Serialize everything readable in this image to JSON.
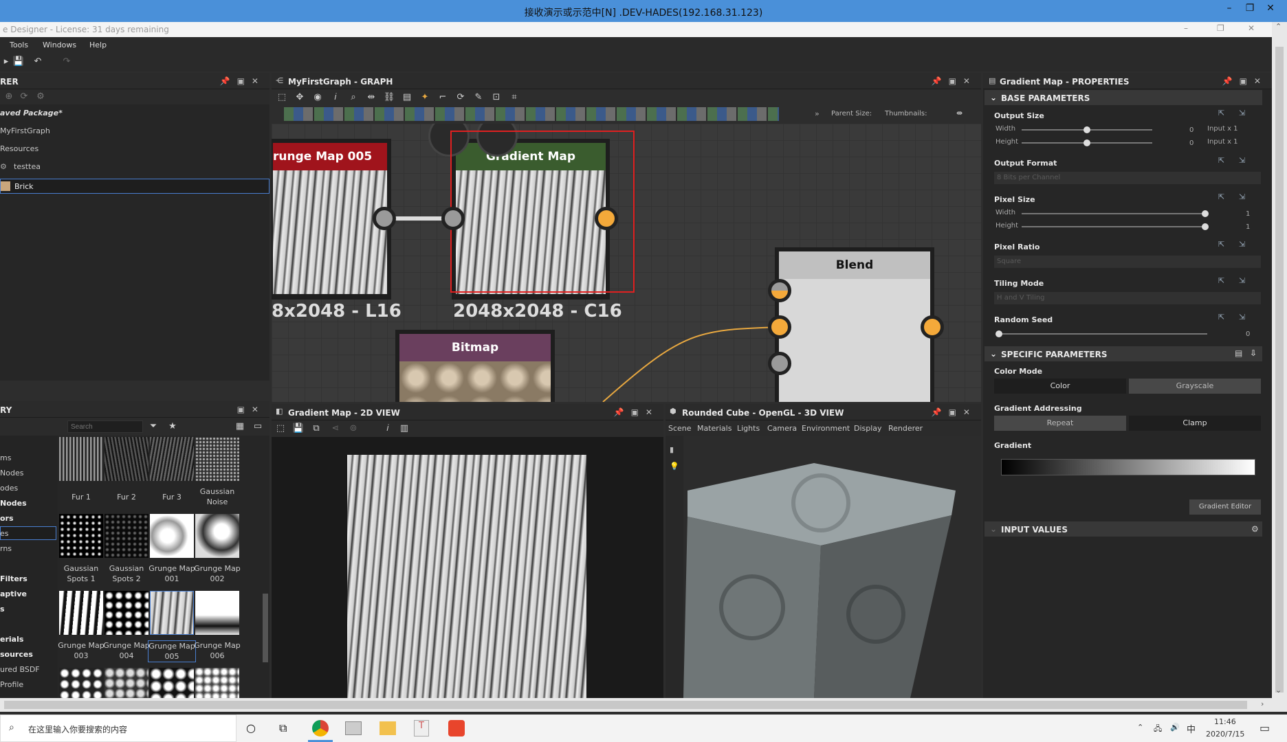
{
  "rdp": {
    "title": "接收演示或示范中[N] .DEV-HADES(192.168.31.123)"
  },
  "app": {
    "title": "e Designer - License: 31 days remaining"
  },
  "menu": [
    "Tools",
    "Windows",
    "Help"
  ],
  "explorer": {
    "title": "RER",
    "items": [
      "aved Package*",
      "MyFirstGraph",
      "Resources",
      "testtea",
      "Brick"
    ]
  },
  "graph": {
    "title": "MyFirstGraph - GRAPH",
    "parent_size": "Parent Size:",
    "thumbnails": "Thumbnails:",
    "nodes": {
      "grunge": {
        "label": "runge Map 005",
        "res": "8x2048 - L16"
      },
      "gradient": {
        "label": "Gradient Map",
        "res": "2048x2048 - C16"
      },
      "bitmap": {
        "label": "Bitmap"
      },
      "blend": {
        "label": "Blend"
      }
    }
  },
  "library": {
    "title": "RY",
    "search_placeholder": "Search",
    "categories": [
      "ms",
      "Nodes",
      "odes",
      "Nodes",
      "ors",
      "es",
      "rns",
      "Filters",
      "aptive",
      "s",
      "erials",
      "sources",
      "ured BSDF",
      "Profile"
    ],
    "thumbs": [
      [
        "Fur 1",
        "Fur 2",
        "Fur 3",
        "Gaussian Noise"
      ],
      [
        "Gaussian Spots 1",
        "Gaussian Spots 2",
        "Grunge Map 001",
        "Grunge Map 002"
      ],
      [
        "Grunge Map 003",
        "Grunge Map 004",
        "Grunge Map 005",
        "Grunge Map 006"
      ]
    ]
  },
  "view2d": {
    "title": "Gradient Map - 2D VIEW"
  },
  "view3d": {
    "title": "Rounded Cube - OpenGL - 3D VIEW",
    "menu": [
      "Scene",
      "Materials",
      "Lights",
      "Camera",
      "Environment",
      "Display",
      "Renderer"
    ]
  },
  "props": {
    "title": "Gradient Map - PROPERTIES",
    "base_section": "BASE PARAMETERS",
    "output_size": {
      "label": "Output Size",
      "width": "Width",
      "height": "Height",
      "w_val": "0",
      "h_val": "0",
      "w_rel": "Input x 1",
      "h_rel": "Input x 1"
    },
    "output_format": {
      "label": "Output Format",
      "value": "8 Bits per Channel"
    },
    "pixel_size": {
      "label": "Pixel Size",
      "width": "Width",
      "height": "Height",
      "w_val": "1",
      "h_val": "1"
    },
    "pixel_ratio": {
      "label": "Pixel Ratio",
      "value": "Square"
    },
    "tiling_mode": {
      "label": "Tiling Mode",
      "value": "H and V Tiling"
    },
    "random_seed": {
      "label": "Random Seed",
      "value": "0"
    },
    "specific_section": "SPECIFIC PARAMETERS",
    "color_mode": {
      "label": "Color Mode",
      "opt1": "Color",
      "opt2": "Grayscale"
    },
    "gradient_addressing": {
      "label": "Gradient Addressing",
      "opt1": "Repeat",
      "opt2": "Clamp"
    },
    "gradient": {
      "label": "Gradient",
      "editor": "Gradient Editor"
    },
    "input_section": "INPUT VALUES"
  },
  "taskbar": {
    "search": "在这里输入你要搜索的内容",
    "time": "11:46",
    "date": "2020/7/15",
    "ime": "中"
  }
}
